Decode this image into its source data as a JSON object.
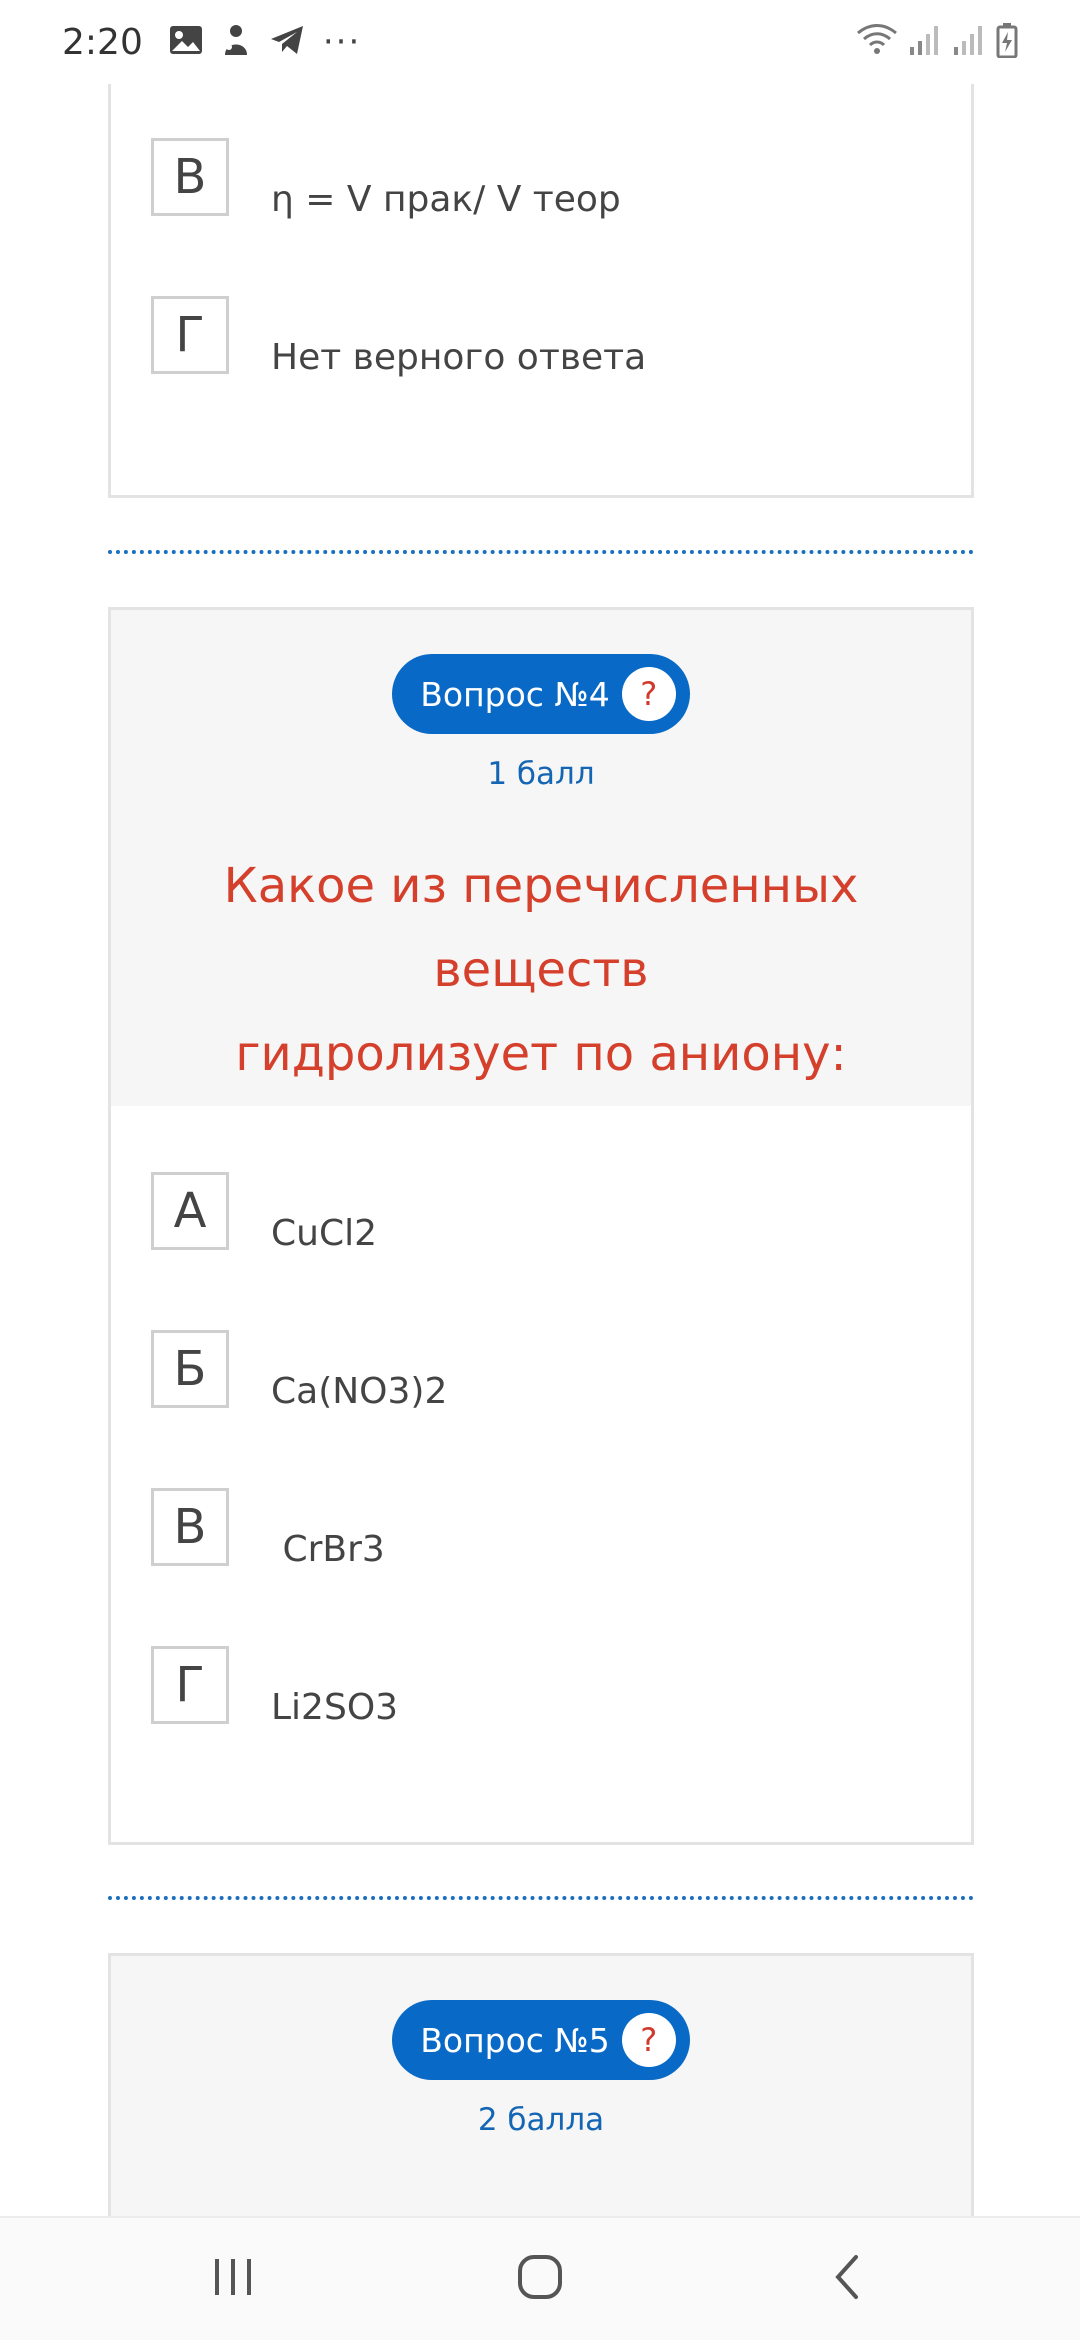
{
  "status_bar": {
    "time": "2:20",
    "left_icons": [
      "gallery-icon",
      "app-icon",
      "telegram-icon"
    ],
    "more": "···",
    "right_icons": [
      "wifi-icon",
      "signal-icon",
      "signal-icon",
      "battery-icon"
    ]
  },
  "question3": {
    "options": [
      {
        "letter": "В",
        "text": "η = V прак/ V теор"
      },
      {
        "letter": "Г",
        "text": "Нет верного ответа"
      }
    ]
  },
  "question4": {
    "badge": "Вопрос №4",
    "help": "?",
    "points": "1 балл",
    "text_line1": "Какое из перечисленных веществ",
    "text_line2": "гидролизует по аниону:",
    "options": [
      {
        "letter": "А",
        "text": "CuCl2"
      },
      {
        "letter": "Б",
        "text": "Ca(NO3)2"
      },
      {
        "letter": "В",
        "text": " CrBr3"
      },
      {
        "letter": "Г",
        "text": "Li2SO3"
      }
    ]
  },
  "question5": {
    "badge": "Вопрос №5",
    "help": "?",
    "points": "2 балла"
  },
  "colors": {
    "accent_blue": "#0869c7",
    "question_red": "#d4402c",
    "points_blue": "#1466b4"
  },
  "nav_bar": {
    "buttons": [
      "recent-apps-icon",
      "home-icon",
      "back-icon"
    ]
  }
}
